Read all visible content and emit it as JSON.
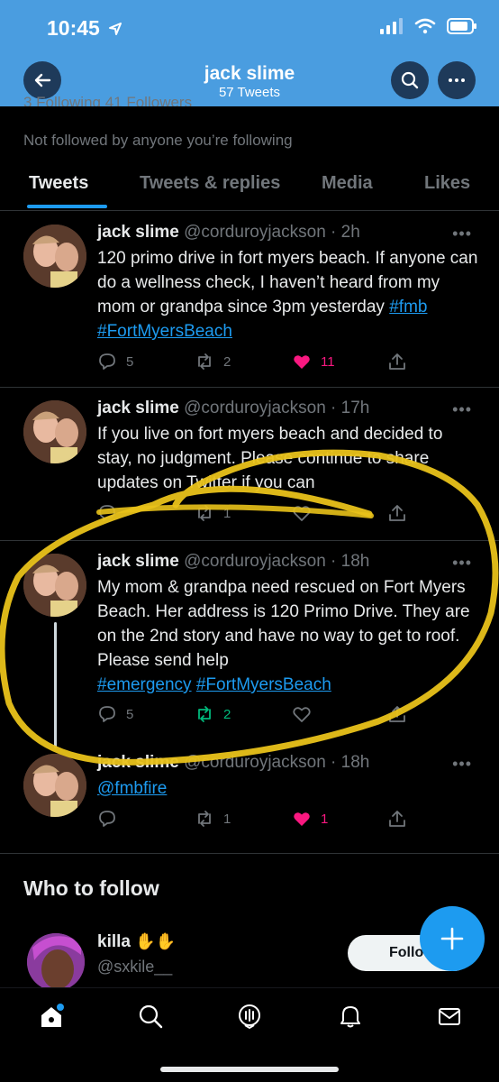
{
  "status": {
    "time": "10:45"
  },
  "header": {
    "title": "jack slime",
    "subtitle": "57 Tweets"
  },
  "profile": {
    "partial_line": "3 Following  41 Followers",
    "not_followed": "Not followed by anyone you’re following"
  },
  "tabs": [
    "Tweets",
    "Tweets & replies",
    "Media",
    "Likes"
  ],
  "tweets": [
    {
      "name": "jack slime",
      "handle": "@corduroyjackson · 2h",
      "text": "120 primo drive in fort myers beach. If anyone can do a wellness check, I haven’t heard from my mom or grandpa since 3pm yesterday",
      "tags": [
        "#fmb",
        "#FortMyersBeach"
      ],
      "replies": "5",
      "retweets": "2",
      "likes": "11"
    },
    {
      "name": "jack slime",
      "handle": "@corduroyjackson · 17h",
      "text": "If you live on fort myers beach and decided to stay, no judgment. Please continue to share updates on Twitter if you can",
      "tags": [],
      "replies": "",
      "retweets": "1",
      "likes": ""
    },
    {
      "name": "jack slime",
      "handle": "@corduroyjackson · 18h",
      "text": "My mom & grandpa need rescued on Fort Myers Beach. Her address is 120 Primo Drive. They are on the 2nd story and have no way to get to roof. Please send help",
      "tags": [
        "#emergency",
        "#FortMyersBeach"
      ],
      "replies": "5",
      "retweets": "2",
      "likes": ""
    },
    {
      "name": "jack slime",
      "handle": "@corduroyjackson · 18h",
      "text": "",
      "tags": [
        "@fmbfire"
      ],
      "replies": "",
      "retweets": "1",
      "likes": "1"
    }
  ],
  "more_glyph": "•••",
  "who_to_follow": {
    "title": "Who to follow",
    "name": "killa",
    "handle": "@sxkile__",
    "button": "Follow"
  },
  "colors": {
    "accent": "#1d9bf0",
    "header_bg": "#4a9de0",
    "like": "#f91880",
    "retweet": "#00ba7c",
    "scribble": "#e9c21a"
  },
  "icons": [
    "back-arrow-icon",
    "search-icon",
    "more-icon",
    "reply-icon",
    "retweet-icon",
    "like-icon",
    "share-icon",
    "compose-icon",
    "home-icon",
    "spaces-icon",
    "notifications-icon",
    "messages-icon"
  ]
}
